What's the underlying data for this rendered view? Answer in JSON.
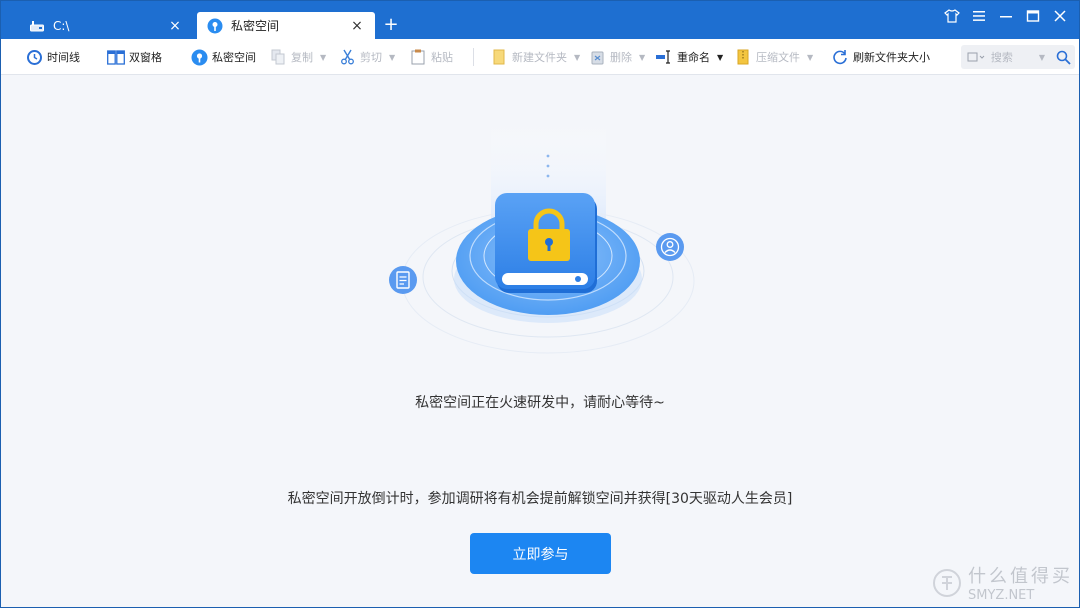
{
  "tabs": [
    {
      "label": "C:\\",
      "icon": "drive-icon",
      "active": false,
      "close": "×"
    },
    {
      "label": "私密空间",
      "icon": "private-space-icon",
      "active": true,
      "close": "×"
    }
  ],
  "new_tab": "+",
  "window_controls": [
    "skin-icon",
    "menu-icon",
    "minimize-icon",
    "maximize-icon",
    "close-icon"
  ],
  "toolbar": {
    "timeline": "时间线",
    "dual_pane": "双窗格",
    "private_space": "私密空间",
    "copy": "复制",
    "cut": "剪切",
    "paste": "粘贴",
    "new_folder": "新建文件夹",
    "delete": "删除",
    "rename": "重命名",
    "compress": "压缩文件",
    "refresh_size": "刷新文件夹大小"
  },
  "search": {
    "placeholder": "搜索"
  },
  "main": {
    "status_message": "私密空间正在火速研发中，请耐心等待~",
    "countdown_message": "私密空间开放倒计时，参加调研将有机会提前解锁空间并获得[30天驱动人生会员]",
    "join_button": "立即参与"
  },
  "watermark": {
    "cn": "什么值得买",
    "en": "SMYZ.NET"
  },
  "colors": {
    "accent": "#1e6fd1",
    "button": "#1c86f2",
    "lock": "#f5c518"
  }
}
